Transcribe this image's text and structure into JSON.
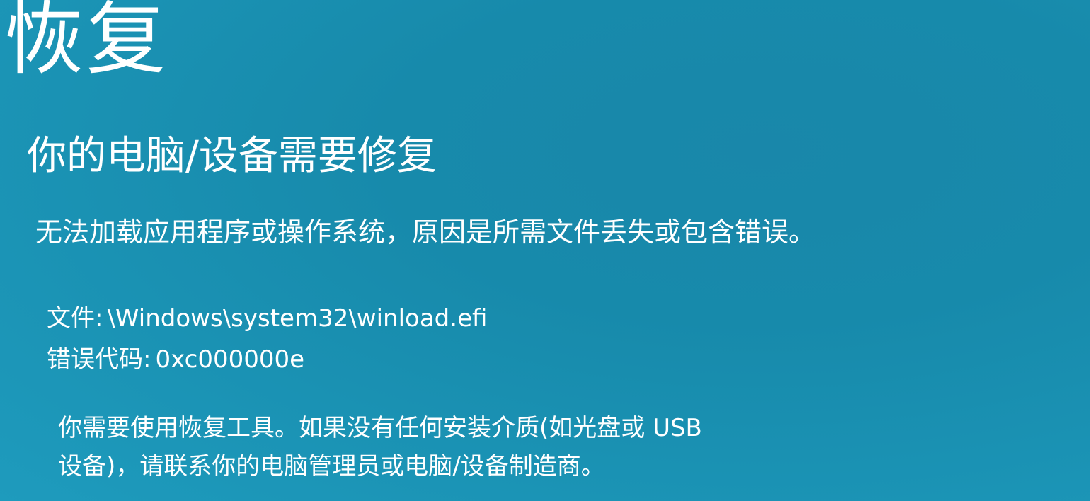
{
  "recovery": {
    "title": "恢复",
    "subtitle": "你的电脑/设备需要修复",
    "message": "无法加载应用程序或操作系统，原因是所需文件丢失或包含错误。",
    "file": {
      "label": "文件:",
      "value": "\\Windows\\system32\\winload.efi"
    },
    "error_code": {
      "label": "错误代码:",
      "value": "0xc000000e"
    },
    "advice": {
      "line1": "你需要使用恢复工具。如果没有任何安装介质(如光盘或 USB",
      "line2": "设备)，请联系你的电脑管理员或电脑/设备制造商。"
    }
  },
  "colors": {
    "background": "#1a8fb0",
    "text": "#ffffff"
  }
}
